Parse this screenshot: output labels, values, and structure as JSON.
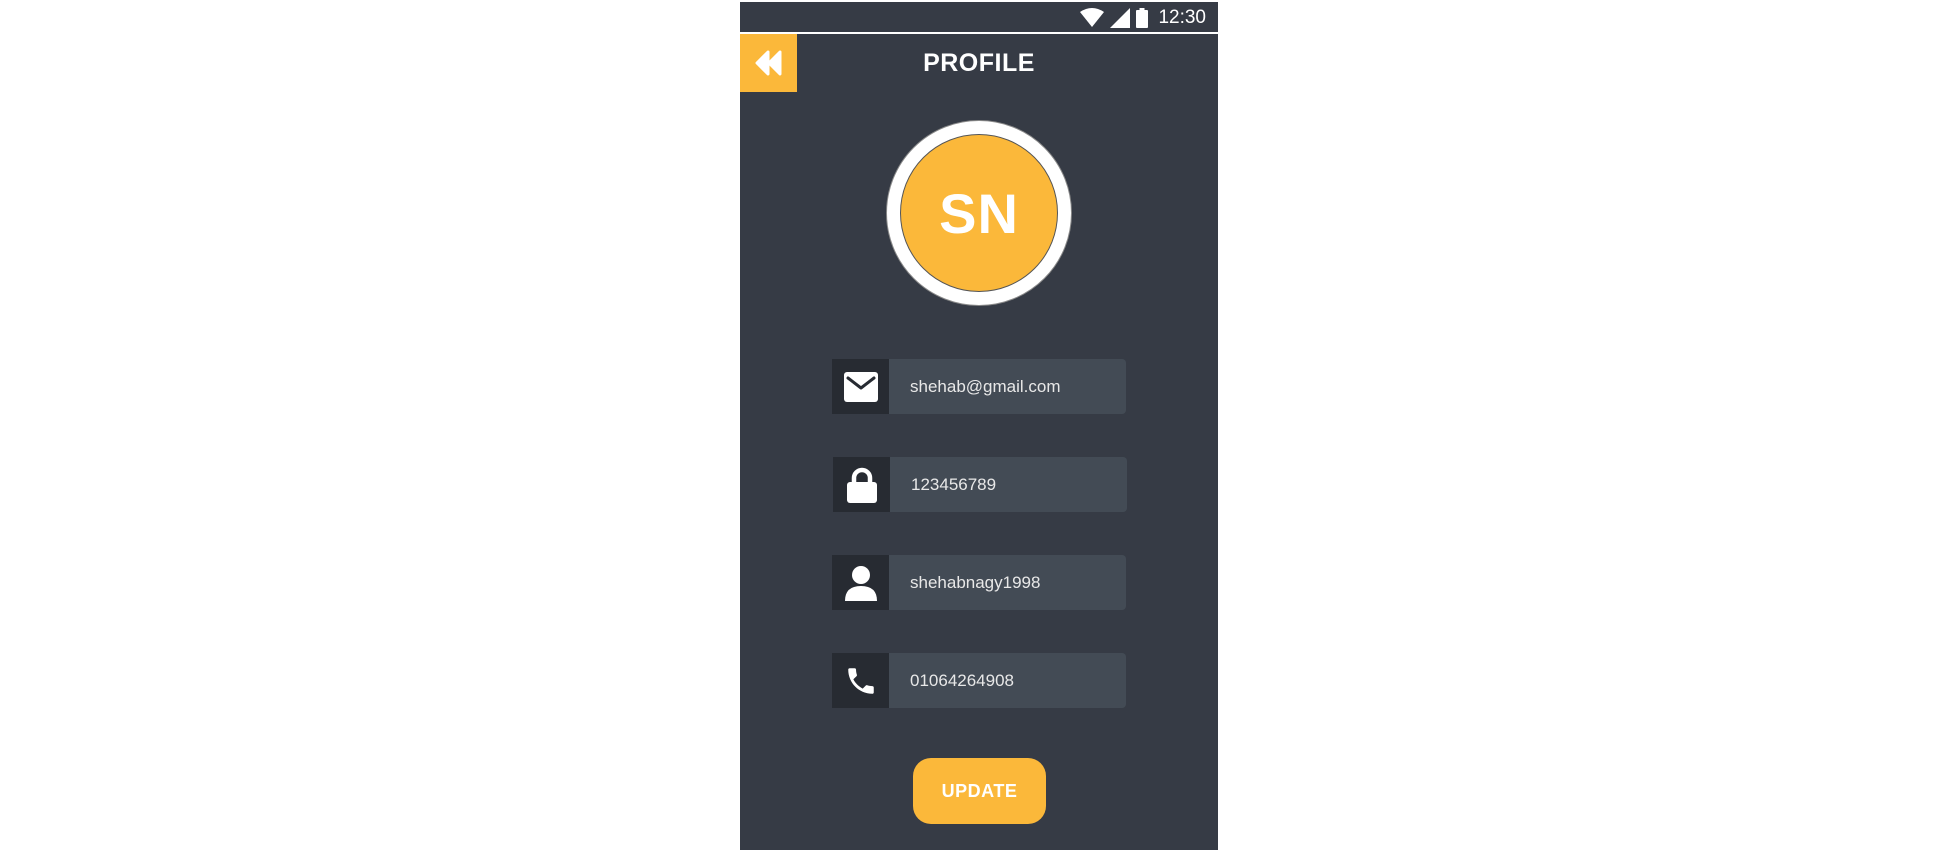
{
  "status_bar": {
    "time": "12:30",
    "icons": [
      "wifi-icon",
      "signal-icon",
      "battery-icon"
    ]
  },
  "header": {
    "title": "PROFILE",
    "back_icon": "double-chevron-left-icon"
  },
  "avatar": {
    "initials": "SN"
  },
  "fields": {
    "email": {
      "icon": "mail-icon",
      "value": "shehab@gmail.com"
    },
    "password": {
      "icon": "lock-icon",
      "value": "123456789"
    },
    "username": {
      "icon": "user-icon",
      "value": "shehabnagy1998"
    },
    "phone": {
      "icon": "phone-icon",
      "value": "01064264908"
    }
  },
  "actions": {
    "update_label": "UPDATE"
  },
  "colors": {
    "accent": "#fbb83a",
    "background": "#363b45",
    "field_bg": "#434b55",
    "icon_bg": "#272b32"
  }
}
